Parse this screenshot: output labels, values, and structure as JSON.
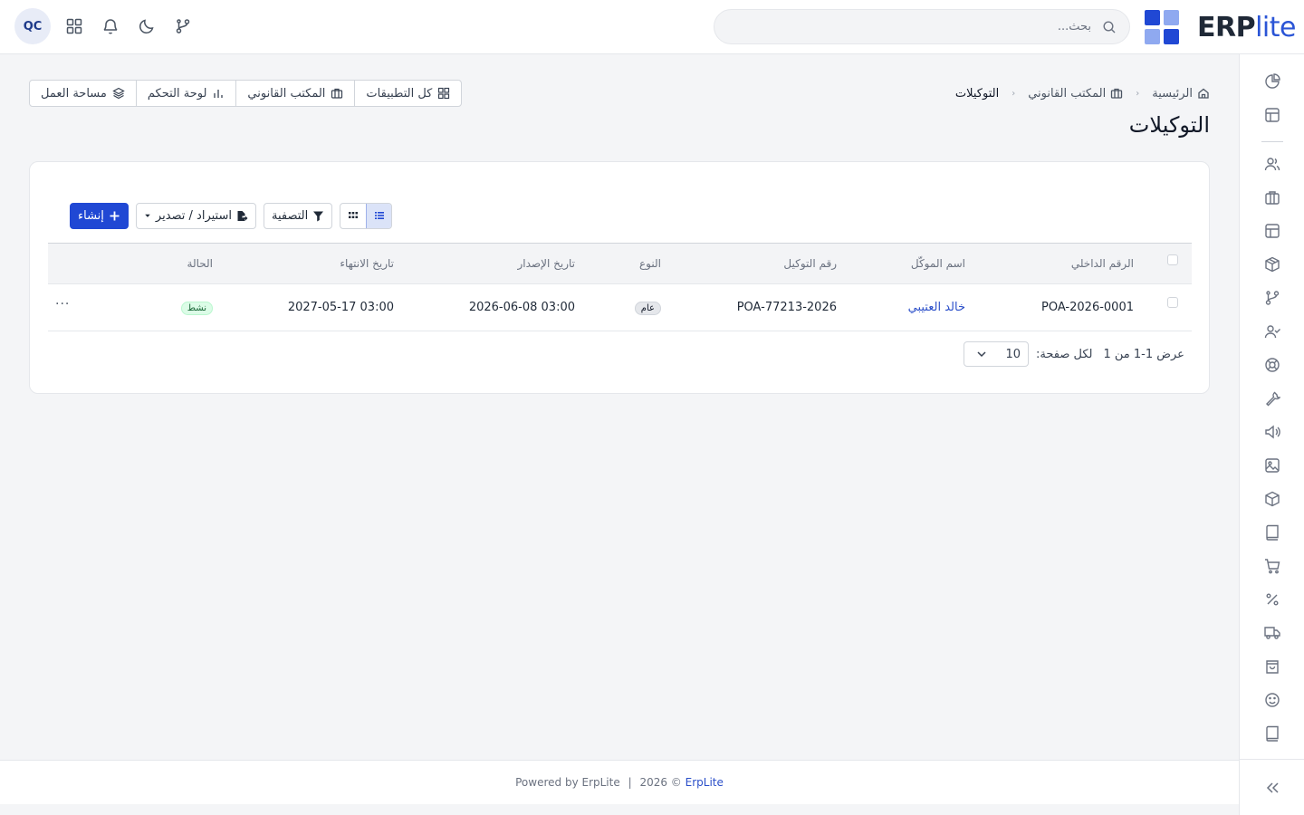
{
  "header": {
    "avatar_initials": "QC",
    "search_placeholder": "بحث...",
    "logo_erp": "ERP",
    "logo_lite": "lite"
  },
  "breadcrumb": {
    "home": "الرئيسية",
    "section": "المكتب القانوني",
    "current": "التوكيلات"
  },
  "page_title": "التوكيلات",
  "appnav": {
    "all_apps": "كل التطبيقات",
    "legal_office": "المكتب القانوني",
    "dashboard": "لوحة التحكم",
    "workspace": "مساحة العمل"
  },
  "toolbar": {
    "create": "إنشاء",
    "import_export": "استيراد / تصدير",
    "filter": "التصفية"
  },
  "table": {
    "headers": {
      "internal_no": "الرقم الداخلي",
      "client_name": "اسم الموكّل",
      "poa_no": "رقم التوكيل",
      "type": "النوع",
      "issue_date": "تاريخ الإصدار",
      "expiry_date": "تاريخ الانتهاء",
      "status": "الحالة"
    },
    "rows": [
      {
        "internal_no": "POA-2026-0001",
        "client_name": "خالد العتيبي",
        "poa_no": "POA-77213-2026",
        "type": "عام",
        "issue_date": "2026-06-08 03:00",
        "expiry_date": "2027-05-17 03:00",
        "status": "نشط",
        "more": "···"
      }
    ]
  },
  "pagination": {
    "showing": "عرض 1-1 من 1",
    "per_page_label": "لكل صفحة:",
    "per_page_value": "10"
  },
  "footer": {
    "powered": "Powered by ErpLite",
    "separator": "|",
    "year": "2026 ©",
    "brand": "ErpLite"
  },
  "colors": {
    "primary": "#2048d4",
    "link": "#2b4fc9",
    "status_active_bg": "#dcfce7"
  }
}
